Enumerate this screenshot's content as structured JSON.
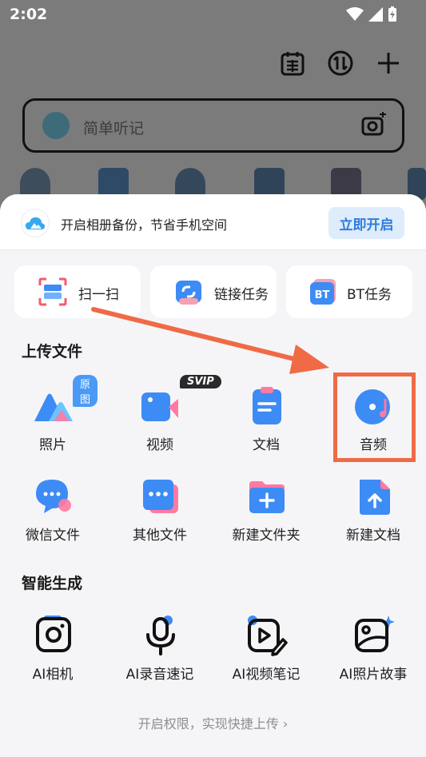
{
  "status_bar": {
    "time": "2:02"
  },
  "search": {
    "placeholder": "简单听记"
  },
  "banner": {
    "text": "开启相册备份，节省手机空间",
    "button": "立即开启"
  },
  "quick_actions": [
    {
      "label": "扫一扫",
      "icon": "scan-icon"
    },
    {
      "label": "链接任务",
      "icon": "link-task-icon"
    },
    {
      "label": "BT任务",
      "icon": "bt-task-icon",
      "icon_text": "BT"
    }
  ],
  "upload_section": {
    "title": "上传文件",
    "items": [
      {
        "label": "照片",
        "icon": "photo-icon",
        "badge": "原图"
      },
      {
        "label": "视频",
        "icon": "video-icon",
        "badge": "SVIP"
      },
      {
        "label": "文档",
        "icon": "document-icon"
      },
      {
        "label": "音频",
        "icon": "audio-icon"
      },
      {
        "label": "微信文件",
        "icon": "wechat-file-icon"
      },
      {
        "label": "其他文件",
        "icon": "other-file-icon"
      },
      {
        "label": "新建文件夹",
        "icon": "new-folder-icon"
      },
      {
        "label": "新建文档",
        "icon": "new-document-icon"
      }
    ]
  },
  "ai_section": {
    "title": "智能生成",
    "items": [
      {
        "label": "AI相机",
        "icon": "camera-icon"
      },
      {
        "label": "AI录音速记",
        "icon": "microphone-icon"
      },
      {
        "label": "AI视频笔记",
        "icon": "video-note-icon"
      },
      {
        "label": "AI照片故事",
        "icon": "photo-story-icon"
      }
    ]
  },
  "footer": {
    "link": "开启权限，实现快捷上传 ›"
  },
  "colors": {
    "accent": "#2d7be0",
    "annotation": "#f06a45",
    "sheet_bg": "#f5f5f7"
  }
}
